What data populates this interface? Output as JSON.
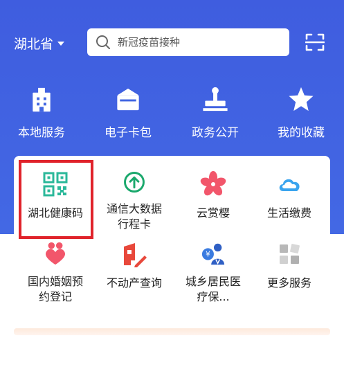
{
  "header": {
    "region": "湖北省",
    "search_placeholder": "新冠疫苗接种"
  },
  "quick_links": [
    {
      "label": "本地服务",
      "icon": "building-icon"
    },
    {
      "label": "电子卡包",
      "icon": "wallet-icon"
    },
    {
      "label": "政务公开",
      "icon": "stamp-icon"
    },
    {
      "label": "我的收藏",
      "icon": "star-icon"
    }
  ],
  "services": [
    {
      "label": "湖北健康码",
      "icon": "qr-code-icon"
    },
    {
      "label": "通信大数据行程卡",
      "icon": "arrow-up-circle-icon"
    },
    {
      "label": "云赏樱",
      "icon": "cherry-blossom-icon"
    },
    {
      "label": "生活缴费",
      "icon": "cloud-icon"
    },
    {
      "label": "国内婚姻预约登记",
      "icon": "heart-people-icon"
    },
    {
      "label": "不动产查询",
      "icon": "house-pen-icon"
    },
    {
      "label": "城乡居民医疗保...",
      "icon": "medical-insurance-icon"
    },
    {
      "label": "更多服务",
      "icon": "more-grid-icon"
    }
  ],
  "colors": {
    "primary_blue": "#4166e2",
    "highlight_red": "#e0232b",
    "qr_green": "#2bb89a",
    "cherry_pink": "#f2566b",
    "cloud_blue": "#3aa4ee"
  }
}
